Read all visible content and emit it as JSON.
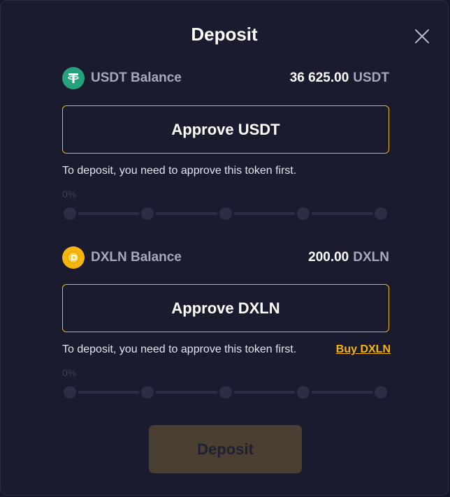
{
  "modal": {
    "title": "Deposit",
    "close_icon": "close-icon"
  },
  "usdt": {
    "label": "USDT Balance",
    "amount": "36 625.00",
    "unit": "USDT",
    "icon": "tether-icon",
    "icon_color": "#26a17b",
    "approve_label": "Approve USDT",
    "note": "To deposit, you need to approve this token first.",
    "progress_text": "0%",
    "progress": 0
  },
  "dxln": {
    "label": "DXLN Balance",
    "amount": "200.00",
    "unit": "DXLN",
    "icon": "dxln-coin-icon",
    "icon_color": "#f5b50f",
    "approve_label": "Approve DXLN",
    "note": "To deposit, you need to approve this token first.",
    "buy_link": "Buy DXLN",
    "progress_text": "0%",
    "progress": 0
  },
  "deposit_button": {
    "label": "Deposit",
    "enabled": false
  },
  "colors": {
    "accent": "#f5b50f",
    "background": "#1a1b2f"
  }
}
